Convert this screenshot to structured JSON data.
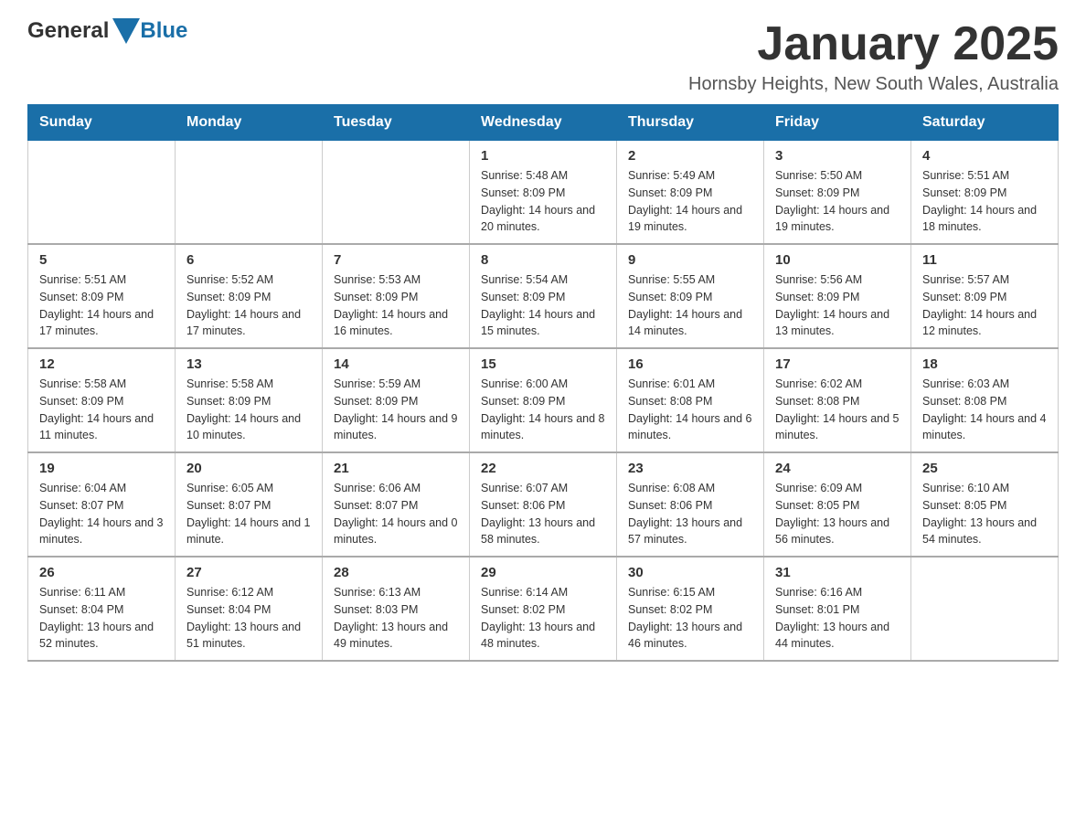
{
  "logo": {
    "text_general": "General",
    "text_blue": "Blue"
  },
  "header": {
    "month_title": "January 2025",
    "location": "Hornsby Heights, New South Wales, Australia"
  },
  "weekdays": [
    "Sunday",
    "Monday",
    "Tuesday",
    "Wednesday",
    "Thursday",
    "Friday",
    "Saturday"
  ],
  "weeks": [
    [
      {
        "day": "",
        "sunrise": "",
        "sunset": "",
        "daylight": ""
      },
      {
        "day": "",
        "sunrise": "",
        "sunset": "",
        "daylight": ""
      },
      {
        "day": "",
        "sunrise": "",
        "sunset": "",
        "daylight": ""
      },
      {
        "day": "1",
        "sunrise": "Sunrise: 5:48 AM",
        "sunset": "Sunset: 8:09 PM",
        "daylight": "Daylight: 14 hours and 20 minutes."
      },
      {
        "day": "2",
        "sunrise": "Sunrise: 5:49 AM",
        "sunset": "Sunset: 8:09 PM",
        "daylight": "Daylight: 14 hours and 19 minutes."
      },
      {
        "day": "3",
        "sunrise": "Sunrise: 5:50 AM",
        "sunset": "Sunset: 8:09 PM",
        "daylight": "Daylight: 14 hours and 19 minutes."
      },
      {
        "day": "4",
        "sunrise": "Sunrise: 5:51 AM",
        "sunset": "Sunset: 8:09 PM",
        "daylight": "Daylight: 14 hours and 18 minutes."
      }
    ],
    [
      {
        "day": "5",
        "sunrise": "Sunrise: 5:51 AM",
        "sunset": "Sunset: 8:09 PM",
        "daylight": "Daylight: 14 hours and 17 minutes."
      },
      {
        "day": "6",
        "sunrise": "Sunrise: 5:52 AM",
        "sunset": "Sunset: 8:09 PM",
        "daylight": "Daylight: 14 hours and 17 minutes."
      },
      {
        "day": "7",
        "sunrise": "Sunrise: 5:53 AM",
        "sunset": "Sunset: 8:09 PM",
        "daylight": "Daylight: 14 hours and 16 minutes."
      },
      {
        "day": "8",
        "sunrise": "Sunrise: 5:54 AM",
        "sunset": "Sunset: 8:09 PM",
        "daylight": "Daylight: 14 hours and 15 minutes."
      },
      {
        "day": "9",
        "sunrise": "Sunrise: 5:55 AM",
        "sunset": "Sunset: 8:09 PM",
        "daylight": "Daylight: 14 hours and 14 minutes."
      },
      {
        "day": "10",
        "sunrise": "Sunrise: 5:56 AM",
        "sunset": "Sunset: 8:09 PM",
        "daylight": "Daylight: 14 hours and 13 minutes."
      },
      {
        "day": "11",
        "sunrise": "Sunrise: 5:57 AM",
        "sunset": "Sunset: 8:09 PM",
        "daylight": "Daylight: 14 hours and 12 minutes."
      }
    ],
    [
      {
        "day": "12",
        "sunrise": "Sunrise: 5:58 AM",
        "sunset": "Sunset: 8:09 PM",
        "daylight": "Daylight: 14 hours and 11 minutes."
      },
      {
        "day": "13",
        "sunrise": "Sunrise: 5:58 AM",
        "sunset": "Sunset: 8:09 PM",
        "daylight": "Daylight: 14 hours and 10 minutes."
      },
      {
        "day": "14",
        "sunrise": "Sunrise: 5:59 AM",
        "sunset": "Sunset: 8:09 PM",
        "daylight": "Daylight: 14 hours and 9 minutes."
      },
      {
        "day": "15",
        "sunrise": "Sunrise: 6:00 AM",
        "sunset": "Sunset: 8:09 PM",
        "daylight": "Daylight: 14 hours and 8 minutes."
      },
      {
        "day": "16",
        "sunrise": "Sunrise: 6:01 AM",
        "sunset": "Sunset: 8:08 PM",
        "daylight": "Daylight: 14 hours and 6 minutes."
      },
      {
        "day": "17",
        "sunrise": "Sunrise: 6:02 AM",
        "sunset": "Sunset: 8:08 PM",
        "daylight": "Daylight: 14 hours and 5 minutes."
      },
      {
        "day": "18",
        "sunrise": "Sunrise: 6:03 AM",
        "sunset": "Sunset: 8:08 PM",
        "daylight": "Daylight: 14 hours and 4 minutes."
      }
    ],
    [
      {
        "day": "19",
        "sunrise": "Sunrise: 6:04 AM",
        "sunset": "Sunset: 8:07 PM",
        "daylight": "Daylight: 14 hours and 3 minutes."
      },
      {
        "day": "20",
        "sunrise": "Sunrise: 6:05 AM",
        "sunset": "Sunset: 8:07 PM",
        "daylight": "Daylight: 14 hours and 1 minute."
      },
      {
        "day": "21",
        "sunrise": "Sunrise: 6:06 AM",
        "sunset": "Sunset: 8:07 PM",
        "daylight": "Daylight: 14 hours and 0 minutes."
      },
      {
        "day": "22",
        "sunrise": "Sunrise: 6:07 AM",
        "sunset": "Sunset: 8:06 PM",
        "daylight": "Daylight: 13 hours and 58 minutes."
      },
      {
        "day": "23",
        "sunrise": "Sunrise: 6:08 AM",
        "sunset": "Sunset: 8:06 PM",
        "daylight": "Daylight: 13 hours and 57 minutes."
      },
      {
        "day": "24",
        "sunrise": "Sunrise: 6:09 AM",
        "sunset": "Sunset: 8:05 PM",
        "daylight": "Daylight: 13 hours and 56 minutes."
      },
      {
        "day": "25",
        "sunrise": "Sunrise: 6:10 AM",
        "sunset": "Sunset: 8:05 PM",
        "daylight": "Daylight: 13 hours and 54 minutes."
      }
    ],
    [
      {
        "day": "26",
        "sunrise": "Sunrise: 6:11 AM",
        "sunset": "Sunset: 8:04 PM",
        "daylight": "Daylight: 13 hours and 52 minutes."
      },
      {
        "day": "27",
        "sunrise": "Sunrise: 6:12 AM",
        "sunset": "Sunset: 8:04 PM",
        "daylight": "Daylight: 13 hours and 51 minutes."
      },
      {
        "day": "28",
        "sunrise": "Sunrise: 6:13 AM",
        "sunset": "Sunset: 8:03 PM",
        "daylight": "Daylight: 13 hours and 49 minutes."
      },
      {
        "day": "29",
        "sunrise": "Sunrise: 6:14 AM",
        "sunset": "Sunset: 8:02 PM",
        "daylight": "Daylight: 13 hours and 48 minutes."
      },
      {
        "day": "30",
        "sunrise": "Sunrise: 6:15 AM",
        "sunset": "Sunset: 8:02 PM",
        "daylight": "Daylight: 13 hours and 46 minutes."
      },
      {
        "day": "31",
        "sunrise": "Sunrise: 6:16 AM",
        "sunset": "Sunset: 8:01 PM",
        "daylight": "Daylight: 13 hours and 44 minutes."
      },
      {
        "day": "",
        "sunrise": "",
        "sunset": "",
        "daylight": ""
      }
    ]
  ]
}
